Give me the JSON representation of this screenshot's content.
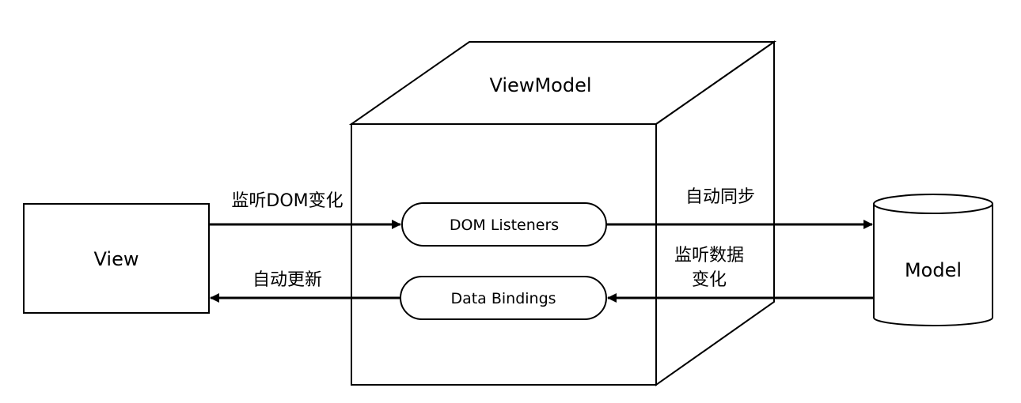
{
  "nodes": {
    "view": {
      "label": "View"
    },
    "viewmodel": {
      "label": "ViewModel"
    },
    "model": {
      "label": "Model"
    },
    "dom_listeners": {
      "label": "DOM Listeners"
    },
    "data_bindings": {
      "label": "Data Bindings"
    }
  },
  "edges": {
    "listen_dom": {
      "label": "监听DOM变化"
    },
    "auto_sync": {
      "label": "自动同步"
    },
    "listen_data": {
      "label_line1": "监听数据",
      "label_line2": "变化"
    },
    "auto_update": {
      "label": "自动更新"
    }
  },
  "colors": {
    "stroke": "#000000",
    "fill": "#ffffff",
    "text": "#000000"
  }
}
